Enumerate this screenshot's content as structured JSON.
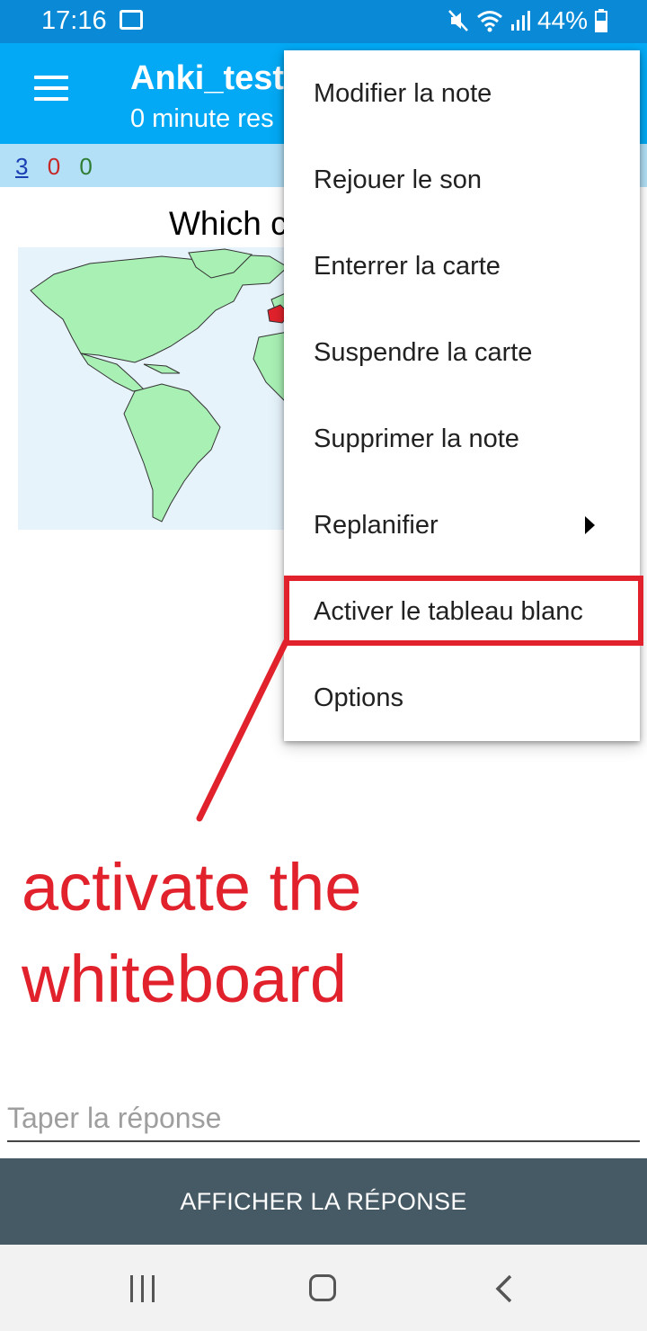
{
  "status_bar": {
    "time": "17:16",
    "battery": "44%"
  },
  "toolbar": {
    "title": "Anki_test",
    "subtitle": "0 minute res"
  },
  "counts": {
    "new": "3",
    "learn": "0",
    "review": "0"
  },
  "card": {
    "question": "Which c"
  },
  "menu": {
    "items": [
      {
        "label": "Modifier la note"
      },
      {
        "label": "Rejouer le son"
      },
      {
        "label": "Enterrer la carte"
      },
      {
        "label": "Suspendre la carte"
      },
      {
        "label": "Supprimer la note"
      },
      {
        "label": "Replanifier",
        "has_submenu": true
      },
      {
        "label": "Activer le tableau blanc",
        "highlighted": true
      },
      {
        "label": "Options"
      }
    ]
  },
  "annotation": {
    "text": "activate the whiteboard",
    "color": "#e1222c"
  },
  "answer": {
    "placeholder": "Taper la réponse",
    "value": ""
  },
  "show_answer": {
    "label": "AFFICHER LA RÉPONSE"
  },
  "colors": {
    "status_bar": "#0a8ad6",
    "toolbar": "#03a9f4",
    "counts_bar": "#b3e0f7",
    "button": "#455a64",
    "land": "#a8f0b4"
  },
  "icons": [
    "message-icon",
    "mute-icon",
    "wifi-icon",
    "signal-icon",
    "battery-icon",
    "hamburger-icon",
    "submenu-arrow-icon",
    "recent-apps-icon",
    "home-icon",
    "back-icon"
  ]
}
